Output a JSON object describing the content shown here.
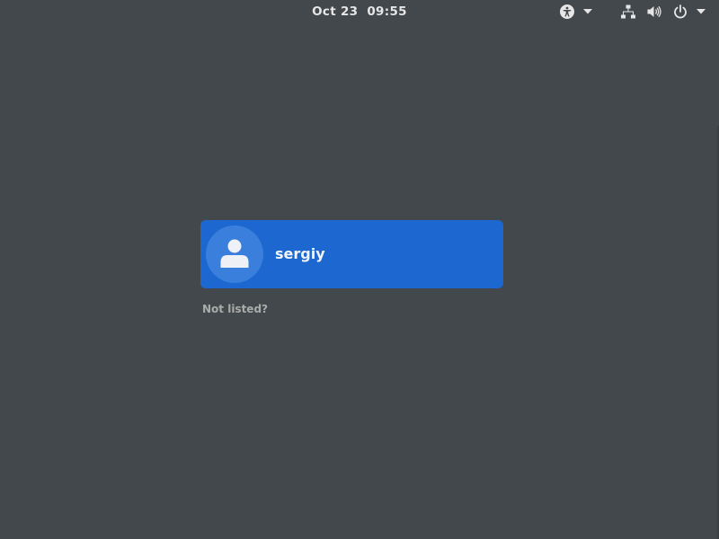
{
  "topbar": {
    "clock": "Oct 23  09:55"
  },
  "tray": {
    "accessibility_icon": "accessibility-icon",
    "network_icon": "network-wired-icon",
    "volume_icon": "volume-icon",
    "power_icon": "power-icon",
    "caret_icon": "chevron-down-icon"
  },
  "login": {
    "users": [
      {
        "name": "sergiy",
        "avatar_icon": "user-avatar-icon"
      }
    ],
    "not_listed_label": "Not listed?"
  },
  "colors": {
    "background": "#43484c",
    "user_card": "#1c68d0",
    "avatar_bg": "#3a7fdb",
    "text_primary": "#f2f4f7",
    "text_muted": "#a9acaa"
  }
}
